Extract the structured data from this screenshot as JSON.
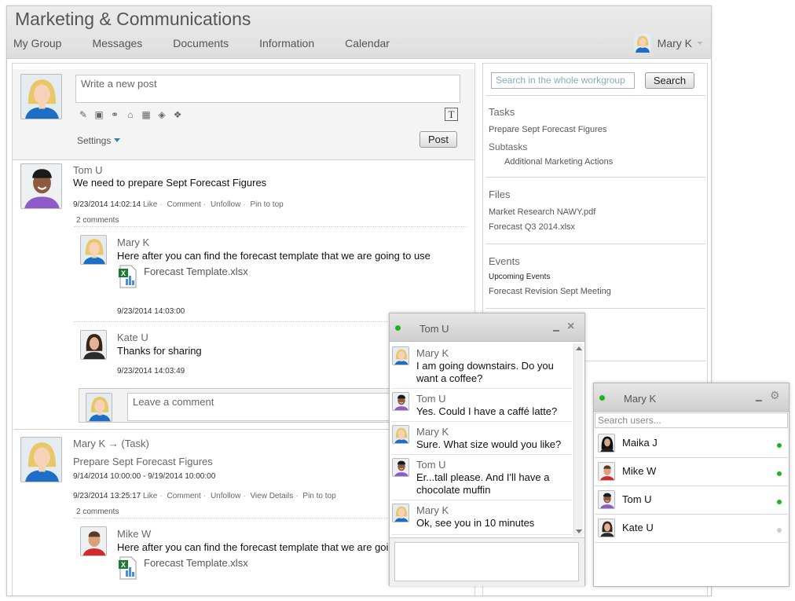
{
  "app": {
    "title": "Marketing & Communications"
  },
  "nav": [
    "My Group",
    "Messages",
    "Documents",
    "Information",
    "Calendar"
  ],
  "user": {
    "name": "Mary K"
  },
  "composer": {
    "placeholder": "Write a new post",
    "settings_label": "Settings",
    "post_label": "Post"
  },
  "colors": {
    "accent": "#2a86a8",
    "online": "#1fb51f",
    "offline": "#cccccc"
  },
  "posts": [
    {
      "author": "Tom U",
      "text": "We need to prepare Sept Forecast Figures",
      "timestamp": "9/23/2014 14:02:14",
      "actions": [
        "Like",
        "Comment",
        "Unfollow",
        "Pin to top"
      ],
      "comments_count": "2 comments",
      "comments": [
        {
          "author": "Mary K",
          "text": "Here after you can find the forecast template that we are going to use",
          "attachment": "Forecast Template.xlsx",
          "timestamp": "9/23/2014 14:03:00"
        },
        {
          "author": "Kate U",
          "text": "Thanks for sharing",
          "timestamp": "9/23/2014 14:03:49"
        }
      ],
      "comment_placeholder": "Leave a comment"
    },
    {
      "author": "Mary K → (Task)",
      "task_title": "Prepare Sept Forecast Figures",
      "task_range": "9/14/2014 10:00:00 - 9/19/2014 10:00:00",
      "timestamp": "9/23/2014 13:25:17",
      "actions": [
        "Like",
        "Comment",
        "Unfollow",
        "View Details",
        "Pin to top"
      ],
      "comments_count": "2 comments",
      "comments": [
        {
          "author": "Mike W",
          "text": "Here after you can find the forecast template that we are going to use",
          "attachment": "Forecast Template.xlsx"
        }
      ]
    }
  ],
  "sidebar": {
    "search_placeholder": "Search in the whole workgroup",
    "search_label": "Search",
    "tasks_heading": "Tasks",
    "task": "Prepare Sept Forecast Figures",
    "subtasks_heading": "Subtasks",
    "subtask": "Additional Marketing Actions",
    "files_heading": "Files",
    "files": [
      "Market Research NAWY.pdf",
      "Forecast Q3 2014.xlsx"
    ],
    "events_heading": "Events",
    "upcoming": "Upcoming Events",
    "event": "Forecast Revision Sept Meeting"
  },
  "chat": {
    "title": "Tom U",
    "messages": [
      {
        "author": "Mary K",
        "text": "I am going downstairs. Do you want a coffee?"
      },
      {
        "author": "Tom U",
        "text": "Yes. Could I have a caffé latte?"
      },
      {
        "author": "Mary K",
        "text": "Sure. What size would you like?"
      },
      {
        "author": "Tom U",
        "text": "Er...tall please. And I'll have a chocolate muffin"
      },
      {
        "author": "Mary K",
        "text": "Ok, see you in 10 minutes"
      }
    ]
  },
  "contacts": {
    "title": "Mary K",
    "search_placeholder": "Search users...",
    "users": [
      {
        "name": "Maika J",
        "status": "online"
      },
      {
        "name": "Mike W",
        "status": "online"
      },
      {
        "name": "Tom U",
        "status": "online"
      },
      {
        "name": "Kate U",
        "status": "offline"
      }
    ]
  }
}
